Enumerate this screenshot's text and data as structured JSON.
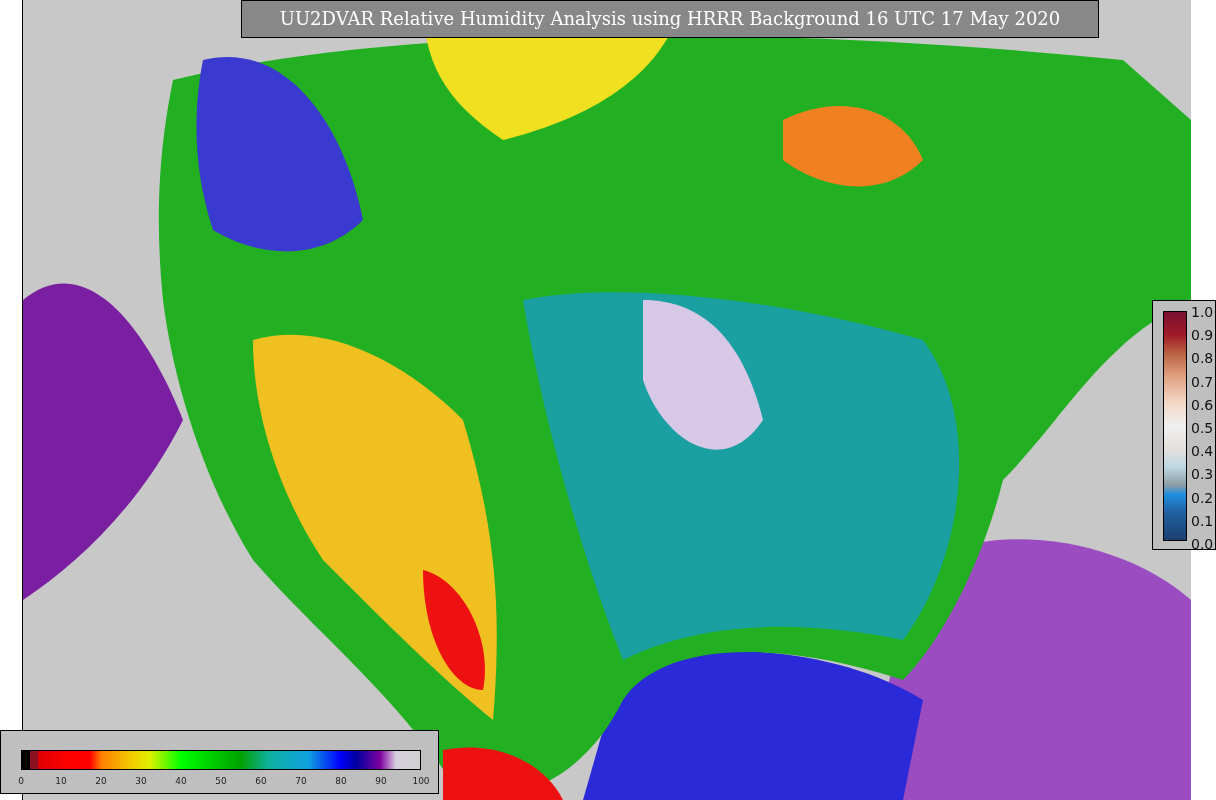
{
  "title": "UU2DVAR Relative Humidity Analysis using HRRR Background 16 UTC 17 May 2020",
  "humidity_colorbar": {
    "ticks": [
      "0",
      "10",
      "20",
      "30",
      "40",
      "50",
      "60",
      "70",
      "80",
      "90",
      "100"
    ]
  },
  "side_colorbar": {
    "ticks": [
      "1.0",
      "0.9",
      "0.8",
      "0.7",
      "0.6",
      "0.5",
      "0.4",
      "0.3",
      "0.2",
      "0.1",
      "0.0"
    ]
  }
}
